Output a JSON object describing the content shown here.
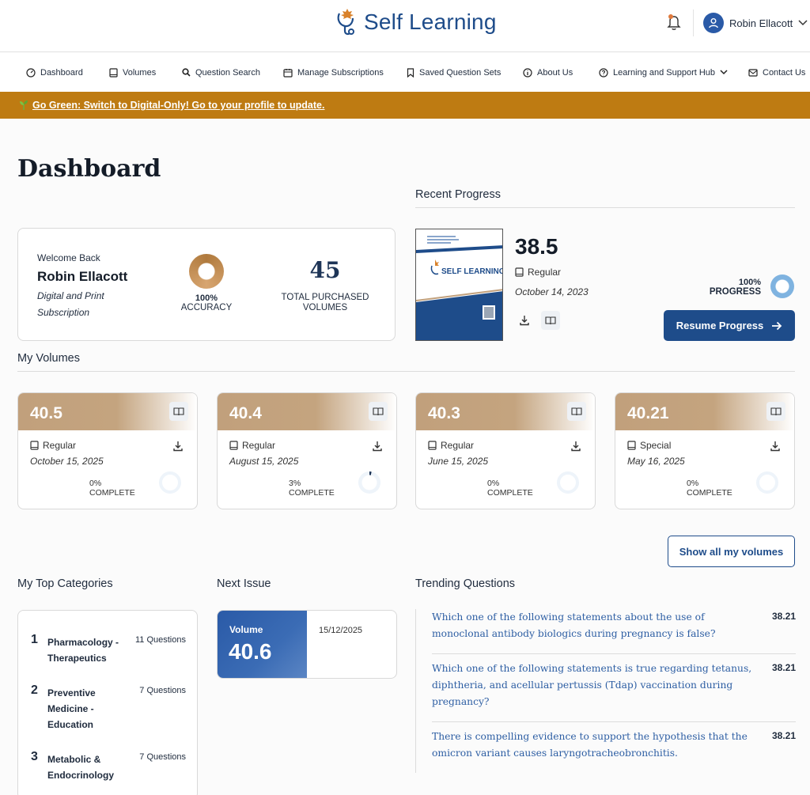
{
  "app": {
    "logo_text": "Self Learning",
    "user_name": "Robin Ellacott"
  },
  "nav": [
    {
      "label": "Dashboard",
      "icon": "dashboard-icon"
    },
    {
      "label": "Volumes",
      "icon": "book-icon"
    },
    {
      "label": "Question Search",
      "icon": "search-icon"
    },
    {
      "label": "Manage Subscriptions",
      "icon": "calendar-icon"
    },
    {
      "label": "Saved Question Sets",
      "icon": "bookmark-icon"
    },
    {
      "label": "About Us",
      "icon": "info-icon"
    },
    {
      "label": "Learning and Support Hub",
      "icon": "help-icon"
    },
    {
      "label": "Contact Us",
      "icon": "mail-icon"
    }
  ],
  "banner": {
    "text": "Go Green: Switch to Digital-Only! Go to your profile to update."
  },
  "page_title": "Dashboard",
  "welcome": {
    "greeting": "Welcome Back",
    "name": "Robin Ellacott",
    "subscription": "Digital and Print Subscription",
    "accuracy_value": "100%",
    "accuracy_label": "ACCURACY",
    "accuracy_fraction": 1.0,
    "volumes_count": "45",
    "volumes_label": "TOTAL PURCHASED VOLUMES"
  },
  "recent": {
    "title": "Recent Progress",
    "volume": "38.5",
    "type": "Regular",
    "date": "October 14, 2023",
    "progress_value": "100%",
    "progress_label": "PROGRESS",
    "progress_fraction": 1.0,
    "resume_label": "Resume Progress",
    "cover_title": "SELF LEARNING"
  },
  "my_volumes": {
    "title": "My Volumes",
    "show_all_label": "Show all my volumes",
    "items": [
      {
        "volume": "40.5",
        "type": "Regular",
        "date": "October 15, 2025",
        "pct": "0%",
        "label": "COMPLETE",
        "fraction": 0.0
      },
      {
        "volume": "40.4",
        "type": "Regular",
        "date": "August 15, 2025",
        "pct": "3%",
        "label": "COMPLETE",
        "fraction": 0.03
      },
      {
        "volume": "40.3",
        "type": "Regular",
        "date": "June 15, 2025",
        "pct": "0%",
        "label": "COMPLETE",
        "fraction": 0.0
      },
      {
        "volume": "40.21",
        "type": "Special",
        "date": "May 16, 2025",
        "pct": "0%",
        "label": "COMPLETE",
        "fraction": 0.0
      }
    ]
  },
  "categories": {
    "title": "My Top Categories",
    "items": [
      {
        "rank": "1",
        "name": "Pharmacology - Therapeutics",
        "count": "11 Questions"
      },
      {
        "rank": "2",
        "name": "Preventive Medicine - Education",
        "count": "7 Questions"
      },
      {
        "rank": "3",
        "name": "Metabolic & Endocrinology",
        "count": "7 Questions"
      }
    ]
  },
  "next_issue": {
    "title": "Next Issue",
    "label": "Volume",
    "volume": "40.6",
    "date": "15/12/2025"
  },
  "trending": {
    "title": "Trending Questions",
    "items": [
      {
        "question": "Which one of the following statements about the use of monoclonal antibody biologics during pregnancy is false?",
        "volume": "38.21"
      },
      {
        "question": "Which one of the following statements is true regarding tetanus, diphtheria, and acellular pertussis (Tdap) vaccination during pregnancy?",
        "volume": "38.21"
      },
      {
        "question": "There is compelling evidence to support the hypothesis that the omicron variant causes laryngotracheobronchitis.",
        "volume": "38.21"
      }
    ]
  },
  "colors": {
    "brand_blue": "#1e4c8a",
    "banner_gold": "#be7b12",
    "accent_gold": "#c1a07c",
    "link_blue": "#2d5ea3"
  }
}
